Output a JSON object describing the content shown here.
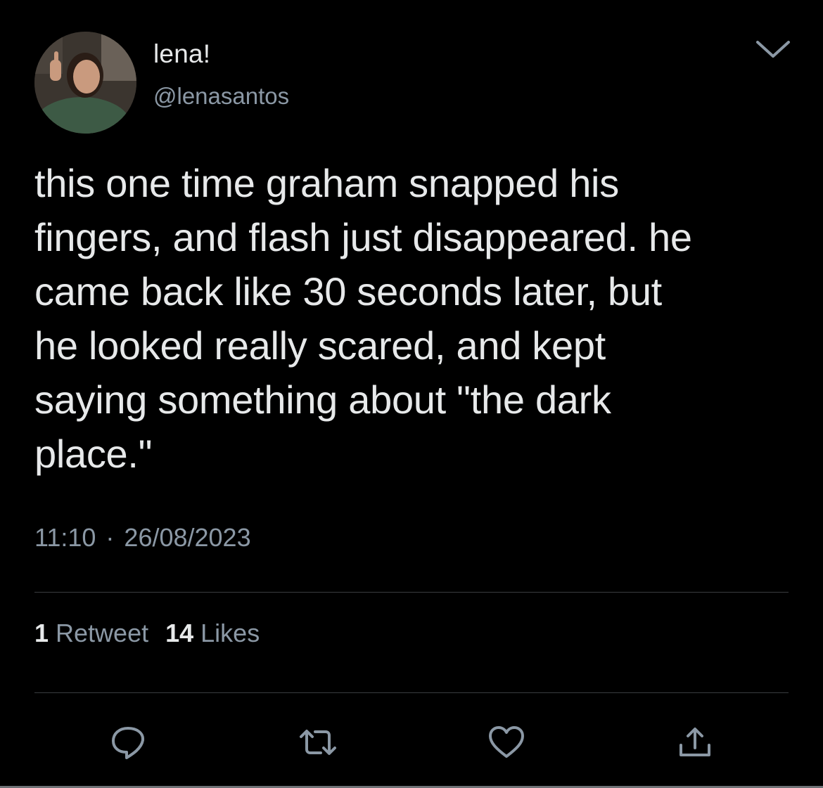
{
  "author": {
    "display_name": "lena!",
    "handle": "@lenasantos"
  },
  "tweet": {
    "text": "this one time graham snapped his\nfingers, and flash just disappeared. he\ncame back like 30 seconds later, but\nhe looked really scared, and kept\nsaying something about \"the dark\nplace.\"",
    "time": "11:10",
    "separator": "·",
    "date": "26/08/2023"
  },
  "stats": {
    "retweets_count": "1",
    "retweets_label": "Retweet",
    "likes_count": "14",
    "likes_label": "Likes"
  },
  "icons": {
    "caret": "chevron-down-icon",
    "reply": "reply-icon",
    "retweet": "retweet-icon",
    "like": "heart-icon",
    "share": "share-icon"
  },
  "colors": {
    "background": "#000000",
    "text_primary": "#e7e9ea",
    "text_secondary": "#8b98a5",
    "divider": "#3a3d40"
  }
}
